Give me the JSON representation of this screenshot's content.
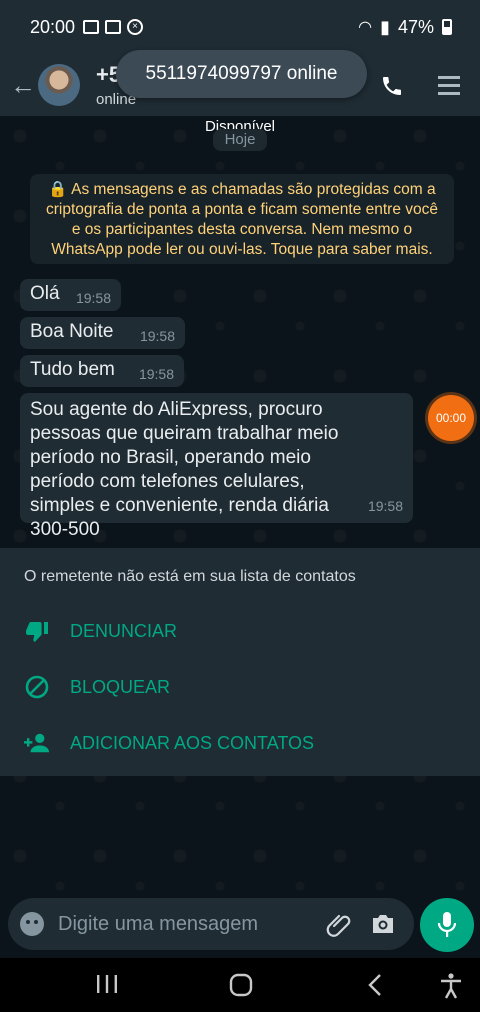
{
  "status_bar": {
    "time": "20:00",
    "battery": "47%"
  },
  "header": {
    "contact_name": "+5",
    "contact_status": "online",
    "toast": "5511974099797 online"
  },
  "chat": {
    "presence_label": "Disponível",
    "date_chip": "Hoje",
    "encryption_notice": "As mensagens e as chamadas são protegidas com a criptografia de ponta a ponta e ficam somente entre você e os participantes desta conversa. Nem mesmo o WhatsApp pode ler ou ouvi-las. Toque para saber mais.",
    "messages": [
      {
        "text": "Olá",
        "time": "19:58"
      },
      {
        "text": "Boa Noite",
        "time": "19:58"
      },
      {
        "text": "Tudo bem",
        "time": "19:58"
      },
      {
        "text": "Sou agente do AliExpress, procuro pessoas que queiram trabalhar meio período no Brasil, operando meio período com telefones celulares, simples e conveniente, renda diária 300-500",
        "time": "19:58"
      }
    ],
    "recording_timer": "00:00"
  },
  "unknown_sender_sheet": {
    "info": "O remetente não está em sua lista de contatos",
    "actions": [
      {
        "label": "DENUNCIAR",
        "icon": "thumbs-down-icon"
      },
      {
        "label": "BLOQUEAR",
        "icon": "block-icon"
      },
      {
        "label": "ADICIONAR AOS CONTATOS",
        "icon": "add-contact-icon"
      }
    ]
  },
  "composer": {
    "placeholder": "Digite uma mensagem"
  },
  "colors": {
    "accent": "#00a884",
    "header": "#1f2c34",
    "bubble": "#202c33",
    "recording": "#f26e12"
  }
}
